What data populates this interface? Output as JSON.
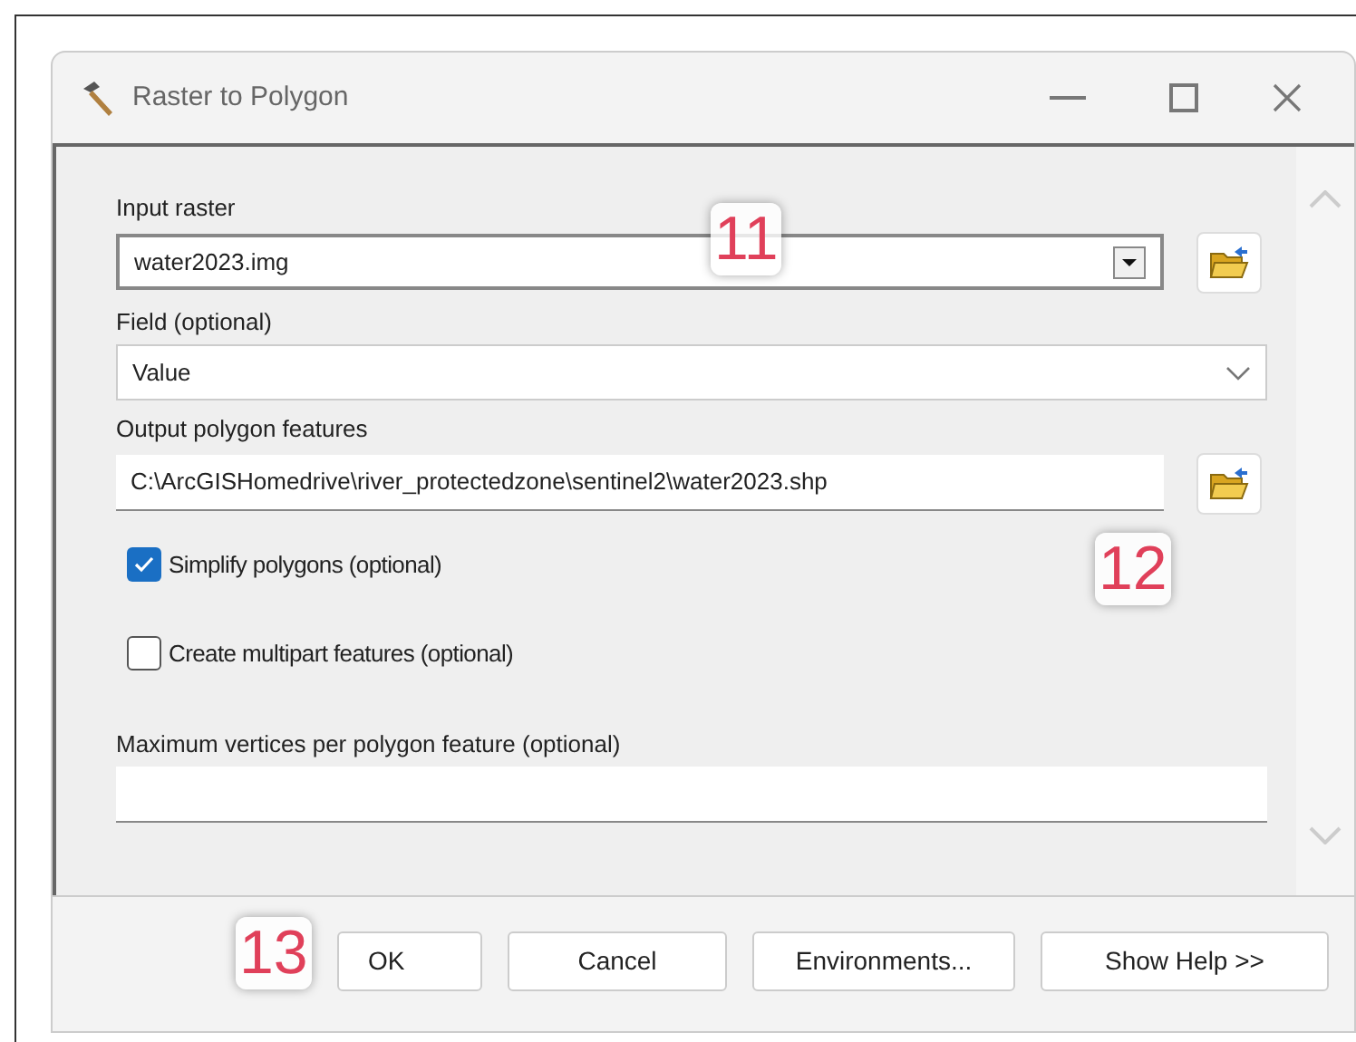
{
  "window": {
    "title": "Raster to Polygon"
  },
  "params": [
    {
      "kind": "combo",
      "label": "Input raster",
      "value": "water2023.img",
      "browse": true
    },
    {
      "kind": "dropdown",
      "label": "Field (optional)",
      "value": "Value",
      "browse": false
    },
    {
      "kind": "text",
      "label": "Output polygon features",
      "value": "C:\\ArcGISHomedrive\\river_protectedzone\\sentinel2\\water2023.shp",
      "browse": true
    },
    {
      "kind": "checkbox",
      "label": "Simplify polygons (optional)",
      "checked": true
    },
    {
      "kind": "checkbox",
      "label": "Create multipart features (optional)",
      "checked": false
    },
    {
      "kind": "text",
      "label": "Maximum vertices per polygon feature (optional)",
      "browse": false
    }
  ],
  "buttons": [
    "OK",
    "Cancel",
    "Environments...",
    "Show Help >>"
  ],
  "callouts": [
    "11",
    "12",
    "13"
  ]
}
